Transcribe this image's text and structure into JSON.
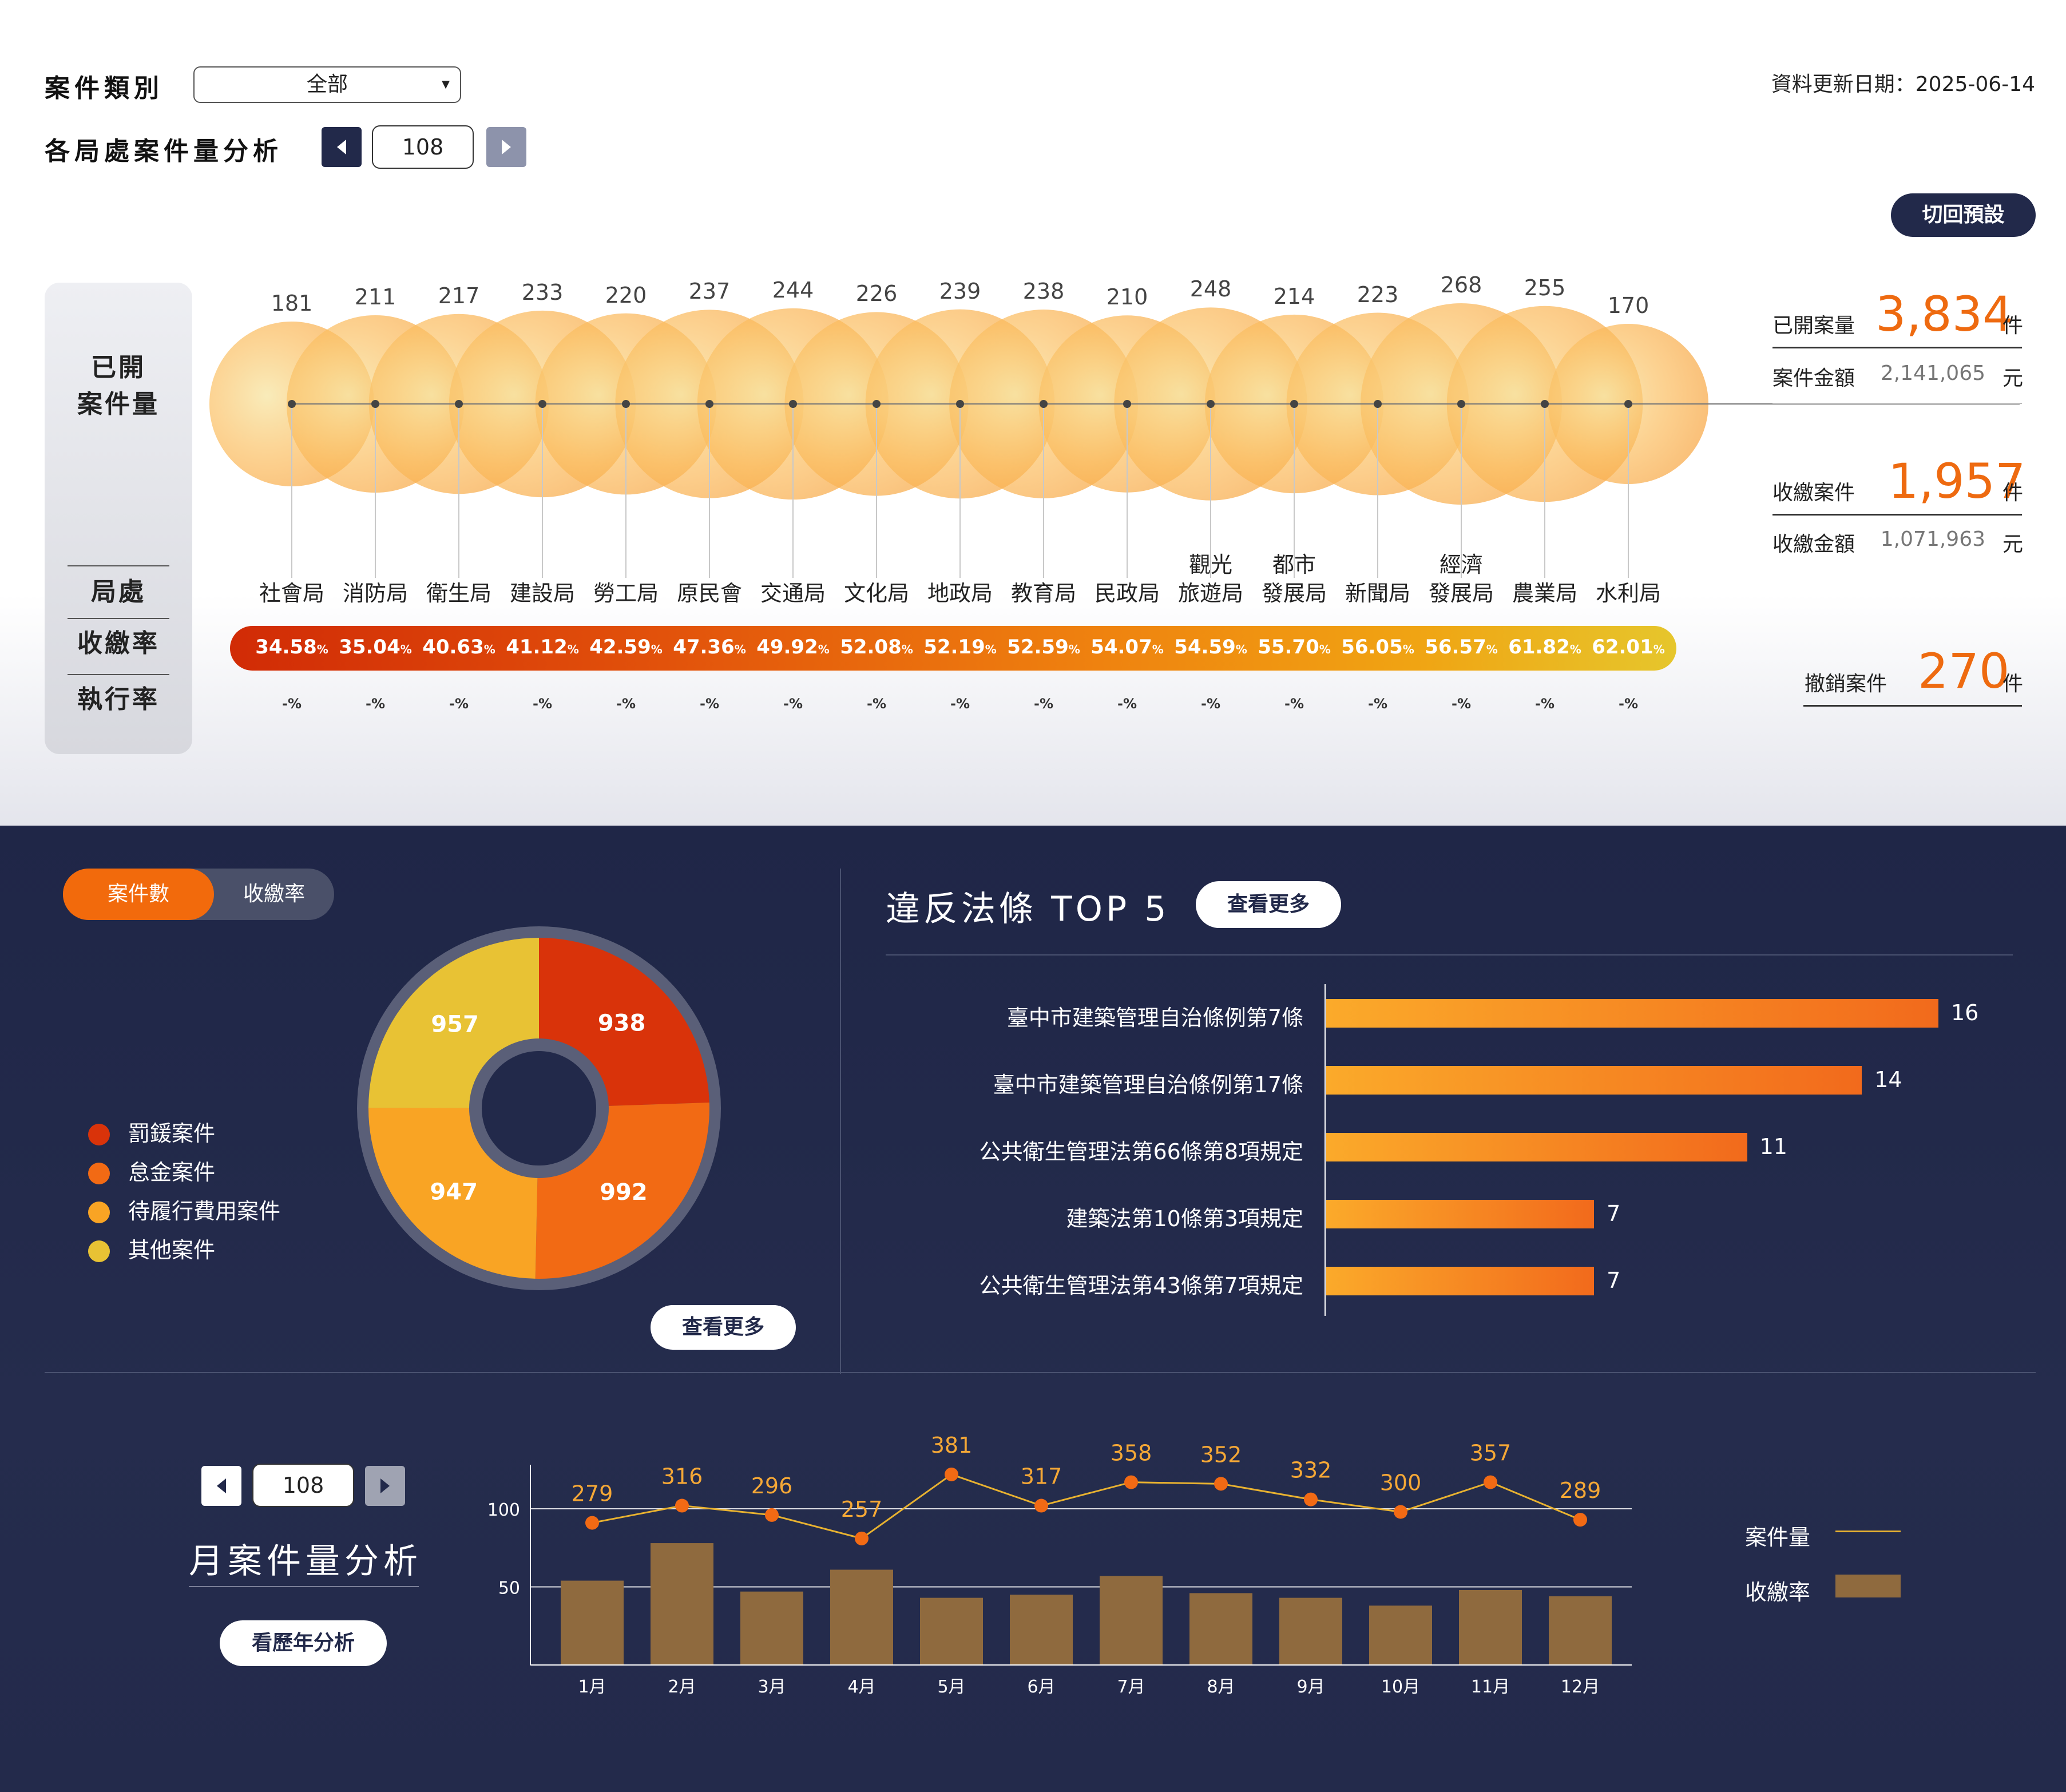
{
  "header": {
    "category_label": "案件類別",
    "category_value": "全部",
    "update_date_text": "資料更新日期：2025-06-14",
    "analysis_label": "各局處案件量分析",
    "year": "108",
    "reset_label": "切回預設"
  },
  "row_labels": {
    "opened_line1": "已開",
    "opened_line2": "案件量",
    "dept": "局處",
    "collection_rate": "收繳率",
    "execution_rate": "執行率"
  },
  "departments": [
    {
      "name1": "",
      "name2": "社會局",
      "value": "181",
      "rate": "34.58",
      "exec": "-"
    },
    {
      "name1": "",
      "name2": "消防局",
      "value": "211",
      "rate": "35.04",
      "exec": "-"
    },
    {
      "name1": "",
      "name2": "衛生局",
      "value": "217",
      "rate": "40.63",
      "exec": "-"
    },
    {
      "name1": "",
      "name2": "建設局",
      "value": "233",
      "rate": "41.12",
      "exec": "-"
    },
    {
      "name1": "",
      "name2": "勞工局",
      "value": "220",
      "rate": "42.59",
      "exec": "-"
    },
    {
      "name1": "",
      "name2": "原民會",
      "value": "237",
      "rate": "47.36",
      "exec": "-"
    },
    {
      "name1": "",
      "name2": "交通局",
      "value": "244",
      "rate": "49.92",
      "exec": "-"
    },
    {
      "name1": "",
      "name2": "文化局",
      "value": "226",
      "rate": "52.08",
      "exec": "-"
    },
    {
      "name1": "",
      "name2": "地政局",
      "value": "239",
      "rate": "52.19",
      "exec": "-"
    },
    {
      "name1": "",
      "name2": "教育局",
      "value": "238",
      "rate": "52.59",
      "exec": "-"
    },
    {
      "name1": "",
      "name2": "民政局",
      "value": "210",
      "rate": "54.07",
      "exec": "-"
    },
    {
      "name1": "觀光",
      "name2": "旅遊局",
      "value": "248",
      "rate": "54.59",
      "exec": "-"
    },
    {
      "name1": "都市",
      "name2": "發展局",
      "value": "214",
      "rate": "55.70",
      "exec": "-"
    },
    {
      "name1": "",
      "name2": "新聞局",
      "value": "223",
      "rate": "56.05",
      "exec": "-"
    },
    {
      "name1": "經濟",
      "name2": "發展局",
      "value": "268",
      "rate": "56.57",
      "exec": "-"
    },
    {
      "name1": "",
      "name2": "農業局",
      "value": "255",
      "rate": "61.82",
      "exec": "-"
    },
    {
      "name1": "",
      "name2": "水利局",
      "value": "170",
      "rate": "62.01",
      "exec": "-"
    }
  ],
  "percent_sign": "%",
  "stats": {
    "opened_label": "已開案量",
    "opened_value": "3,834",
    "unit_case": "件",
    "amount_label": "案件金額",
    "amount_value": "2,141,065",
    "unit_money": "元",
    "collected_label": "收繳案件",
    "collected_value": "1,957",
    "collected_amount_label": "收繳金額",
    "collected_amount_value": "1,071,963",
    "revoked_label": "撤銷案件",
    "revoked_value": "270"
  },
  "donut": {
    "toggle_on": "案件數",
    "toggle_off": "收繳率",
    "more_label": "查看更多",
    "segments": [
      {
        "name": "罰鍰案件",
        "value": 938,
        "color": "#d9330a"
      },
      {
        "name": "怠金案件",
        "value": 992,
        "color": "#f26a14"
      },
      {
        "name": "待履行費用案件",
        "value": 947,
        "color": "#f9a424"
      },
      {
        "name": "其他案件",
        "value": 957,
        "color": "#e8c234"
      }
    ]
  },
  "top5": {
    "title": "違反法條 TOP 5",
    "more_label": "查看更多",
    "items": [
      {
        "label": "臺中市建築管理自治條例第7條",
        "value": 16
      },
      {
        "label": "臺中市建築管理自治條例第17條",
        "value": 14
      },
      {
        "label": "公共衛生管理法第66條第8項規定",
        "value": 11
      },
      {
        "label": "建築法第10條第3項規定",
        "value": 7
      },
      {
        "label": "公共衛生管理法第43條第7項規定",
        "value": 7
      }
    ]
  },
  "monthly": {
    "year": "108",
    "title": "月案件量分析",
    "history_label": "看歷年分析",
    "legend_cases": "案件量",
    "legend_rate": "收繳率",
    "legend_line_color": "#e8b230",
    "legend_bar_color": "#8f6a3e"
  },
  "chart_data": {
    "type": "bar",
    "categories": [
      "1月",
      "2月",
      "3月",
      "4月",
      "5月",
      "6月",
      "7月",
      "8月",
      "9月",
      "10月",
      "11月",
      "12月"
    ],
    "series": [
      {
        "name": "案件量",
        "type": "line",
        "values": [
          279,
          316,
          296,
          257,
          381,
          317,
          358,
          352,
          332,
          300,
          357,
          289
        ],
        "marker_y": [
          91,
          102,
          96,
          81,
          122,
          102,
          117,
          116,
          106,
          98,
          117,
          93
        ]
      },
      {
        "name": "收繳率",
        "type": "bar",
        "values": [
          54,
          78,
          47,
          61,
          43,
          45,
          57,
          46,
          43,
          38,
          48,
          44
        ]
      }
    ],
    "yticks": [
      50,
      100
    ],
    "ylim": [
      0,
      130
    ]
  }
}
